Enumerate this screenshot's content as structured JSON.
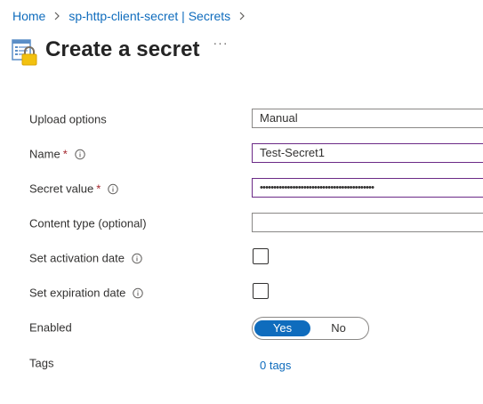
{
  "breadcrumb": {
    "items": [
      {
        "label": "Home"
      },
      {
        "label": "sp-http-client-secret | Secrets"
      }
    ]
  },
  "header": {
    "title": "Create a secret",
    "more_label": "···"
  },
  "form": {
    "upload_options": {
      "label": "Upload options",
      "value": "Manual"
    },
    "name": {
      "label": "Name",
      "required_mark": "*",
      "value": "Test-Secret1"
    },
    "secret_value": {
      "label": "Secret value",
      "required_mark": "*",
      "masked_value": "••••••••••••••••••••••••••••••••••••••••••"
    },
    "content_type": {
      "label": "Content type (optional)",
      "value": ""
    },
    "activation_date": {
      "label": "Set activation date",
      "checked": false
    },
    "expiration_date": {
      "label": "Set expiration date",
      "checked": false
    },
    "enabled": {
      "label": "Enabled",
      "options": [
        "Yes",
        "No"
      ],
      "selected": "Yes"
    },
    "tags": {
      "label": "Tags",
      "link": "0 tags"
    }
  },
  "colors": {
    "link": "#0f6cbd",
    "required": "#a4262c",
    "focused_border": "#6b2a87",
    "toggle_selected": "#0f6cbd"
  }
}
